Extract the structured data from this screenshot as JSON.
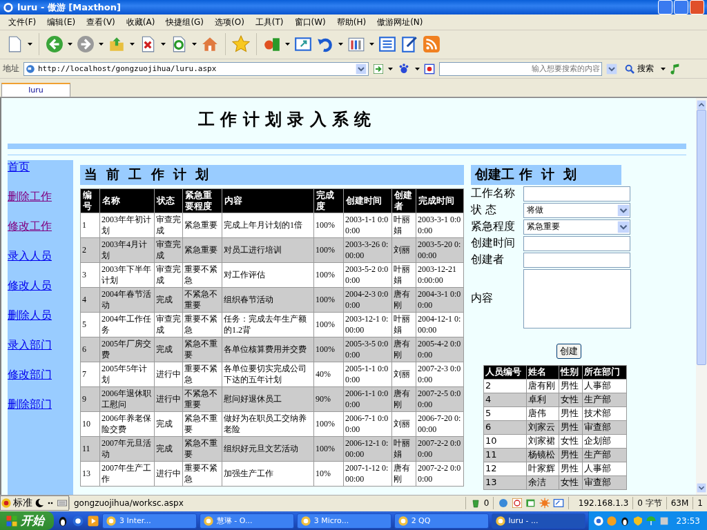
{
  "window": {
    "title": "luru - 傲游 [Maxthon]"
  },
  "menu": [
    "文件(F)",
    "编辑(E)",
    "查看(V)",
    "收藏(A)",
    "快捷组(G)",
    "选项(O)",
    "工具(T)",
    "窗口(W)",
    "帮助(H)",
    "傲游网址(N)"
  ],
  "address_bar": {
    "label": "地址",
    "url": "http://localhost/gongzuojihua/luru.aspx"
  },
  "search": {
    "placeholder": "输入想要搜索的内容",
    "button": "搜索"
  },
  "tabs": [
    {
      "label": "luru",
      "selected": true
    }
  ],
  "page": {
    "title": "工 作 计 划 录 入 系 统",
    "nav": [
      {
        "label": "首页",
        "visited": false
      },
      {
        "label": "删除工作",
        "visited": true
      },
      {
        "label": "修改工作",
        "visited": true
      },
      {
        "label": "录入人员",
        "visited": false
      },
      {
        "label": "修改人员",
        "visited": false
      },
      {
        "label": "删除人员",
        "visited": false
      },
      {
        "label": "录入部门",
        "visited": false
      },
      {
        "label": "修改部门",
        "visited": false
      },
      {
        "label": "删除部门",
        "visited": false
      }
    ],
    "plans": {
      "heading": "当  前  工  作  计  划",
      "columns": [
        "编号",
        "名称",
        "状态",
        "紧急重要程度",
        "内容",
        "完成度",
        "创建时间",
        "创建者",
        "完成时间"
      ],
      "rows": [
        [
          "1",
          "2003年年初计划",
          "审查完成",
          "紧急重要",
          "完成上年月计划的1倍",
          "100%",
          "2003-1-1 0:00:00",
          "叶丽娟",
          "2003-3-1 0:00:00"
        ],
        [
          "2",
          "2003年4月计划",
          "审查完成",
          "紧急重要",
          "对员工进行培训",
          "100%",
          "2003-3-26 0:00:00",
          "刘丽",
          "2003-5-20 0:00:00"
        ],
        [
          "3",
          "2003年下半年计划",
          "审查完成",
          "重要不紧急",
          "对工作评估",
          "100%",
          "2003-5-2 0:00:00",
          "叶丽娟",
          "2003-12-21 0:00:00"
        ],
        [
          "4",
          "2004年春节活动",
          "完成",
          "不紧急不重要",
          "组织春节活动",
          "100%",
          "2004-2-3 0:00:00",
          "唐有刚",
          "2004-3-1 0:00:00"
        ],
        [
          "5",
          "2004年工作任务",
          "审查完成",
          "重要不紧急",
          "任务：完成去年生产额的1.2背",
          "100%",
          "2003-12-1 0:00:00",
          "叶丽娟",
          "2004-12-1 0:00:00"
        ],
        [
          "6",
          "2005年厂房交费",
          "完成",
          "紧急不重要",
          "各单位核算费用并交费",
          "100%",
          "2005-3-5 0:00:00",
          "唐有刚",
          "2005-4-2 0:00:00"
        ],
        [
          "7",
          "2005年5年计划",
          "进行中",
          "重要不紧急",
          "各单位要切实完成公司下达的五年计划",
          "40%",
          "2005-1-1 0:00:00",
          "刘丽",
          "2007-2-3 0:00:00"
        ],
        [
          "9",
          "2006年退休职工慰问",
          "进行中",
          "不紧急不重要",
          "慰问好退休员工",
          "90%",
          "2006-1-1 0:00:00",
          "唐有刚",
          "2007-2-5 0:00:00"
        ],
        [
          "10",
          "2006年养老保险交费",
          "完成",
          "紧急不重要",
          "做好为在职员工交纳养老险",
          "100%",
          "2006-7-1 0:00:00",
          "刘丽",
          "2006-7-20 0:00:00"
        ],
        [
          "11",
          "2007年元旦活动",
          "完成",
          "紧急不重要",
          "组织好元旦文艺活动",
          "100%",
          "2006-12-1 0:00:00",
          "叶丽娟",
          "2007-2-2 0:00:00"
        ],
        [
          "13",
          "2007年生产工作",
          "进行中",
          "重要不紧急",
          "加强生产工作",
          "10%",
          "2007-1-12 0:00:00",
          "唐有刚",
          "2007-2-2 0:00:00"
        ]
      ]
    },
    "create": {
      "heading": "创建工 作  计  划",
      "fields": [
        {
          "label": "工作名称",
          "kind": "text"
        },
        {
          "label": "状 态",
          "kind": "select",
          "value": "将做"
        },
        {
          "label": "紧急程度",
          "kind": "select",
          "value": "紧急重要"
        },
        {
          "label": "创建时间",
          "kind": "text"
        },
        {
          "label": "创建者",
          "kind": "text"
        },
        {
          "label": "内容",
          "kind": "textarea"
        }
      ],
      "button": "创建"
    },
    "staff": {
      "columns": [
        "人员编号",
        "姓名",
        "性别",
        "所在部门"
      ],
      "rows": [
        [
          "2",
          "唐有刚",
          "男性",
          "人事部"
        ],
        [
          "4",
          "卓利",
          "女性",
          "生产部"
        ],
        [
          "5",
          "唐伟",
          "男性",
          "技术部"
        ],
        [
          "6",
          "刘家云",
          "男性",
          "审查部"
        ],
        [
          "10",
          "刘家裙",
          "女性",
          "企划部"
        ],
        [
          "11",
          "杨镜松",
          "男性",
          "生产部"
        ],
        [
          "12",
          "叶家辉",
          "男性",
          "人事部"
        ],
        [
          "13",
          "余洁",
          "女性",
          "审查部"
        ]
      ]
    }
  },
  "status_bar": {
    "ime": "标准",
    "url": "gongzuojihua/worksc.aspx",
    "count": "0",
    "ip": "192.168.1.3",
    "bytes": "0 字节",
    "memory": "63M",
    "number": "1"
  },
  "taskbar": {
    "start": "开始",
    "tasks": [
      {
        "label": "3 Inter...",
        "selected": false
      },
      {
        "label": "慧琳 - O...",
        "selected": false
      },
      {
        "label": "3 Micro...",
        "selected": false
      },
      {
        "label": "2 QQ",
        "selected": false
      },
      {
        "label": "luru - ...",
        "selected": true
      }
    ],
    "clock": "23:53"
  }
}
